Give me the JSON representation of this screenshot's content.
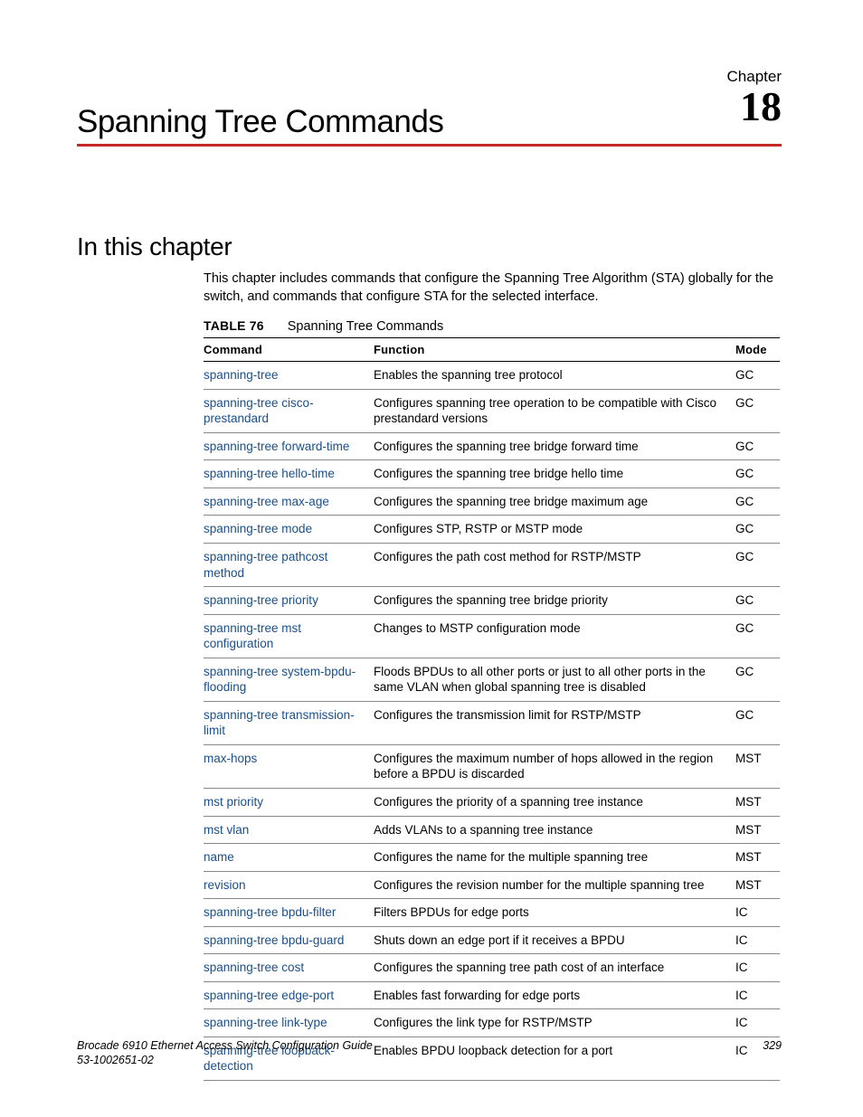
{
  "header": {
    "chapter_label": "Chapter",
    "chapter_number": "18",
    "chapter_title": "Spanning Tree Commands"
  },
  "section": {
    "title": "In this chapter",
    "intro": "This chapter includes commands that configure the Spanning Tree Algorithm (STA) globally for the switch, and commands that configure STA for the selected interface."
  },
  "table": {
    "label": "TABLE 76",
    "caption": "Spanning Tree Commands",
    "headers": {
      "command": "Command",
      "function": "Function",
      "mode": "Mode"
    },
    "rows": [
      {
        "command": "spanning-tree",
        "function": "Enables the spanning tree protocol",
        "mode": "GC"
      },
      {
        "command": "spanning-tree cisco-prestandard",
        "function": "Configures spanning tree operation to be compatible with Cisco prestandard versions",
        "mode": "GC"
      },
      {
        "command": "spanning-tree forward-time",
        "function": "Configures the spanning tree bridge forward time",
        "mode": "GC"
      },
      {
        "command": "spanning-tree hello-time",
        "function": "Configures the spanning tree bridge hello time",
        "mode": "GC"
      },
      {
        "command": "spanning-tree max-age",
        "function": "Configures the spanning tree bridge maximum age",
        "mode": "GC"
      },
      {
        "command": "spanning-tree mode",
        "function": "Configures STP, RSTP or MSTP mode",
        "mode": "GC"
      },
      {
        "command": "spanning-tree pathcost method",
        "function": "Configures the path cost method for RSTP/MSTP",
        "mode": "GC"
      },
      {
        "command": "spanning-tree priority",
        "function": "Configures the spanning tree bridge priority",
        "mode": "GC"
      },
      {
        "command": "spanning-tree mst configuration",
        "function": "Changes to MSTP configuration mode",
        "mode": "GC"
      },
      {
        "command": "spanning-tree system-bpdu-flooding",
        "function": "Floods BPDUs to all other ports or just to all other ports in the same VLAN when global spanning tree is disabled",
        "mode": "GC"
      },
      {
        "command": "spanning-tree transmission-limit",
        "function": "Configures the transmission limit for RSTP/MSTP",
        "mode": "GC"
      },
      {
        "command": "max-hops",
        "function": "Configures the maximum number of hops allowed in the region before a BPDU is discarded",
        "mode": "MST"
      },
      {
        "command": "mst priority",
        "function": "Configures the priority of a spanning tree instance",
        "mode": "MST"
      },
      {
        "command": "mst vlan",
        "function": "Adds VLANs to a spanning tree instance",
        "mode": "MST"
      },
      {
        "command": "name",
        "function": "Configures the name for the multiple spanning tree",
        "mode": "MST"
      },
      {
        "command": "revision",
        "function": "Configures the revision number for the multiple spanning tree",
        "mode": "MST"
      },
      {
        "command": "spanning-tree bpdu-filter",
        "function": "Filters BPDUs for edge ports",
        "mode": "IC"
      },
      {
        "command": "spanning-tree bpdu-guard",
        "function": "Shuts down an edge port if it receives a BPDU",
        "mode": "IC"
      },
      {
        "command": "spanning-tree cost",
        "function": "Configures the spanning tree path cost of an interface",
        "mode": "IC"
      },
      {
        "command": "spanning-tree edge-port",
        "function": "Enables fast forwarding for edge ports",
        "mode": "IC"
      },
      {
        "command": "spanning-tree link-type",
        "function": "Configures the link type for RSTP/MSTP",
        "mode": "IC"
      },
      {
        "command": "spanning-tree loopback-detection",
        "function": "Enables BPDU loopback detection for a port",
        "mode": "IC"
      }
    ]
  },
  "footer": {
    "line1": "Brocade 6910 Ethernet Access Switch Configuration Guide",
    "line2": "53-1002651-02",
    "page_number": "329"
  }
}
